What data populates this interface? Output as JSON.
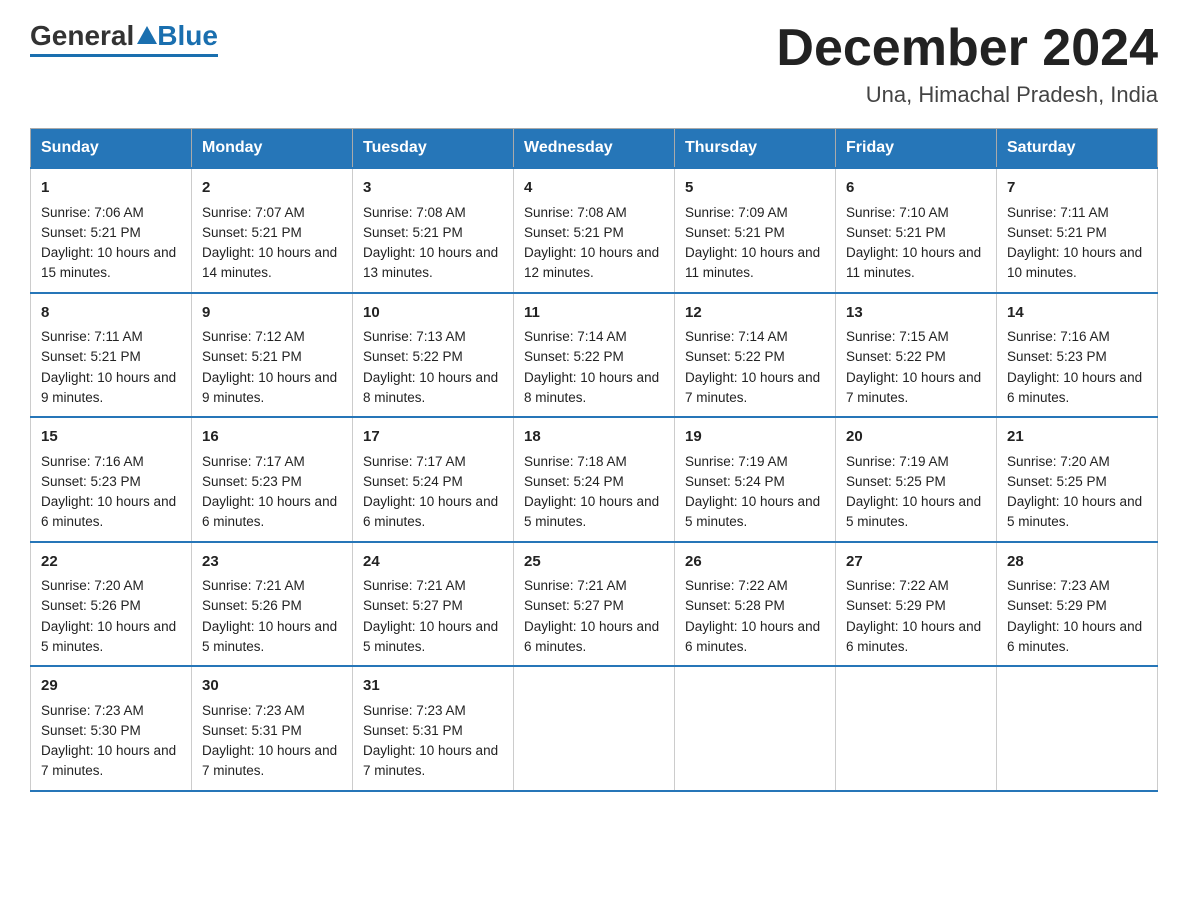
{
  "logo": {
    "general": "General",
    "blue": "Blue"
  },
  "header": {
    "month": "December 2024",
    "location": "Una, Himachal Pradesh, India"
  },
  "days_of_week": [
    "Sunday",
    "Monday",
    "Tuesday",
    "Wednesday",
    "Thursday",
    "Friday",
    "Saturday"
  ],
  "weeks": [
    [
      {
        "day": "1",
        "sunrise": "7:06 AM",
        "sunset": "5:21 PM",
        "daylight": "10 hours and 15 minutes."
      },
      {
        "day": "2",
        "sunrise": "7:07 AM",
        "sunset": "5:21 PM",
        "daylight": "10 hours and 14 minutes."
      },
      {
        "day": "3",
        "sunrise": "7:08 AM",
        "sunset": "5:21 PM",
        "daylight": "10 hours and 13 minutes."
      },
      {
        "day": "4",
        "sunrise": "7:08 AM",
        "sunset": "5:21 PM",
        "daylight": "10 hours and 12 minutes."
      },
      {
        "day": "5",
        "sunrise": "7:09 AM",
        "sunset": "5:21 PM",
        "daylight": "10 hours and 11 minutes."
      },
      {
        "day": "6",
        "sunrise": "7:10 AM",
        "sunset": "5:21 PM",
        "daylight": "10 hours and 11 minutes."
      },
      {
        "day": "7",
        "sunrise": "7:11 AM",
        "sunset": "5:21 PM",
        "daylight": "10 hours and 10 minutes."
      }
    ],
    [
      {
        "day": "8",
        "sunrise": "7:11 AM",
        "sunset": "5:21 PM",
        "daylight": "10 hours and 9 minutes."
      },
      {
        "day": "9",
        "sunrise": "7:12 AM",
        "sunset": "5:21 PM",
        "daylight": "10 hours and 9 minutes."
      },
      {
        "day": "10",
        "sunrise": "7:13 AM",
        "sunset": "5:22 PM",
        "daylight": "10 hours and 8 minutes."
      },
      {
        "day": "11",
        "sunrise": "7:14 AM",
        "sunset": "5:22 PM",
        "daylight": "10 hours and 8 minutes."
      },
      {
        "day": "12",
        "sunrise": "7:14 AM",
        "sunset": "5:22 PM",
        "daylight": "10 hours and 7 minutes."
      },
      {
        "day": "13",
        "sunrise": "7:15 AM",
        "sunset": "5:22 PM",
        "daylight": "10 hours and 7 minutes."
      },
      {
        "day": "14",
        "sunrise": "7:16 AM",
        "sunset": "5:23 PM",
        "daylight": "10 hours and 6 minutes."
      }
    ],
    [
      {
        "day": "15",
        "sunrise": "7:16 AM",
        "sunset": "5:23 PM",
        "daylight": "10 hours and 6 minutes."
      },
      {
        "day": "16",
        "sunrise": "7:17 AM",
        "sunset": "5:23 PM",
        "daylight": "10 hours and 6 minutes."
      },
      {
        "day": "17",
        "sunrise": "7:17 AM",
        "sunset": "5:24 PM",
        "daylight": "10 hours and 6 minutes."
      },
      {
        "day": "18",
        "sunrise": "7:18 AM",
        "sunset": "5:24 PM",
        "daylight": "10 hours and 5 minutes."
      },
      {
        "day": "19",
        "sunrise": "7:19 AM",
        "sunset": "5:24 PM",
        "daylight": "10 hours and 5 minutes."
      },
      {
        "day": "20",
        "sunrise": "7:19 AM",
        "sunset": "5:25 PM",
        "daylight": "10 hours and 5 minutes."
      },
      {
        "day": "21",
        "sunrise": "7:20 AM",
        "sunset": "5:25 PM",
        "daylight": "10 hours and 5 minutes."
      }
    ],
    [
      {
        "day": "22",
        "sunrise": "7:20 AM",
        "sunset": "5:26 PM",
        "daylight": "10 hours and 5 minutes."
      },
      {
        "day": "23",
        "sunrise": "7:21 AM",
        "sunset": "5:26 PM",
        "daylight": "10 hours and 5 minutes."
      },
      {
        "day": "24",
        "sunrise": "7:21 AM",
        "sunset": "5:27 PM",
        "daylight": "10 hours and 5 minutes."
      },
      {
        "day": "25",
        "sunrise": "7:21 AM",
        "sunset": "5:27 PM",
        "daylight": "10 hours and 6 minutes."
      },
      {
        "day": "26",
        "sunrise": "7:22 AM",
        "sunset": "5:28 PM",
        "daylight": "10 hours and 6 minutes."
      },
      {
        "day": "27",
        "sunrise": "7:22 AM",
        "sunset": "5:29 PM",
        "daylight": "10 hours and 6 minutes."
      },
      {
        "day": "28",
        "sunrise": "7:23 AM",
        "sunset": "5:29 PM",
        "daylight": "10 hours and 6 minutes."
      }
    ],
    [
      {
        "day": "29",
        "sunrise": "7:23 AM",
        "sunset": "5:30 PM",
        "daylight": "10 hours and 7 minutes."
      },
      {
        "day": "30",
        "sunrise": "7:23 AM",
        "sunset": "5:31 PM",
        "daylight": "10 hours and 7 minutes."
      },
      {
        "day": "31",
        "sunrise": "7:23 AM",
        "sunset": "5:31 PM",
        "daylight": "10 hours and 7 minutes."
      },
      null,
      null,
      null,
      null
    ]
  ]
}
